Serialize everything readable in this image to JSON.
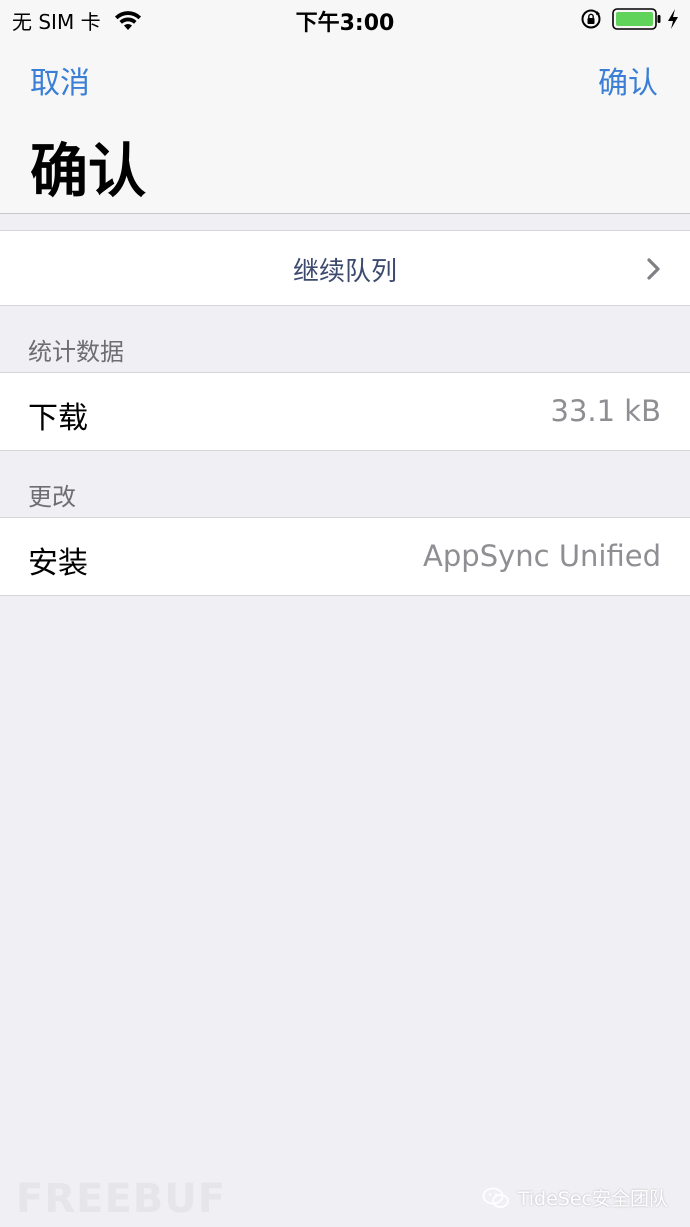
{
  "status_bar": {
    "carrier": "无 SIM 卡",
    "time": "下午3:00",
    "battery_color": "#5fd35a"
  },
  "nav": {
    "cancel_label": "取消",
    "confirm_label": "确认",
    "title": "确认",
    "accent_color": "#3a7fd5"
  },
  "continue_row": {
    "label": "继续队列"
  },
  "sections": {
    "stats": {
      "header": "统计数据",
      "download_label": "下载",
      "download_value": "33.1 kB"
    },
    "changes": {
      "header": "更改",
      "install_label": "安装",
      "install_value": "AppSync Unified"
    }
  },
  "watermark": {
    "left": "FREEBUF",
    "right": "TideSec安全团队"
  }
}
